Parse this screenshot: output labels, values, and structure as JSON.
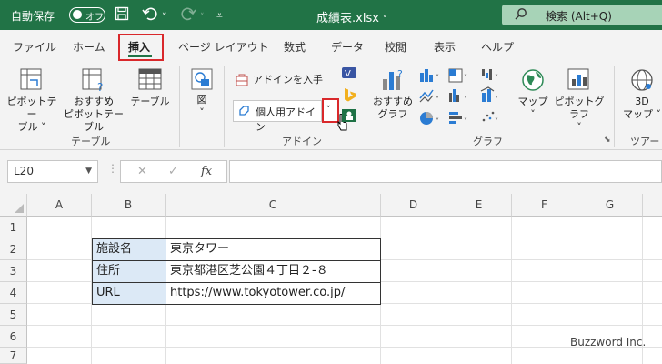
{
  "titlebar": {
    "autosave_label": "自動保存",
    "autosave_state": "オフ",
    "filename": "成績表.xlsx",
    "search_label": "検索 (Alt+Q)",
    "icons": [
      "save-icon",
      "undo-icon",
      "redo-icon",
      "customize-icon"
    ]
  },
  "tabs": [
    "ファイル",
    "ホーム",
    "挿入",
    "ページ レイアウト",
    "数式",
    "データ",
    "校閲",
    "表示",
    "ヘルプ"
  ],
  "active_tab": "挿入",
  "ribbon": {
    "table_group": {
      "label": "テーブル",
      "pivot_line1": "ピボットテー",
      "pivot_line2": "ブル ˅",
      "recommended_line1": "おすすめ",
      "recommended_line2": "ピボットテーブル",
      "table": "テーブル"
    },
    "illustration": {
      "label": "図"
    },
    "addin_group": {
      "label": "アドイン",
      "get_addins": "アドインを入手",
      "my_addins": "個人用アドイン"
    },
    "chart_group": {
      "label": "グラフ",
      "recommended_line1": "おすすめ",
      "recommended_line2": "グラフ",
      "map": "マップ",
      "pivot_chart": "ピボットグラフ"
    },
    "tour_group": {
      "label": "ツアー",
      "map3d_line1": "3D",
      "map3d_line2": "マップ ˅"
    }
  },
  "formula_bar": {
    "name_box": "L20",
    "cancel_glyph": "✕",
    "enter_glyph": "✓",
    "fx_glyph": "fx",
    "formula": ""
  },
  "grid": {
    "columns": [
      "A",
      "B",
      "C",
      "D",
      "E",
      "F",
      "G"
    ],
    "rows": [
      "1",
      "2",
      "3",
      "4",
      "5",
      "6",
      "7"
    ],
    "table": [
      {
        "label": "施設名",
        "value": "東京タワー"
      },
      {
        "label": "住所",
        "value": "東京都港区芝公園４丁目２-８"
      },
      {
        "label": "URL",
        "value": "https://www.tokyotower.co.jp/"
      }
    ]
  },
  "watermark": "Buzzword Inc.",
  "colors": {
    "brand": "#217346",
    "highlight": "#d9282b",
    "label_fill": "#dce9f6"
  }
}
